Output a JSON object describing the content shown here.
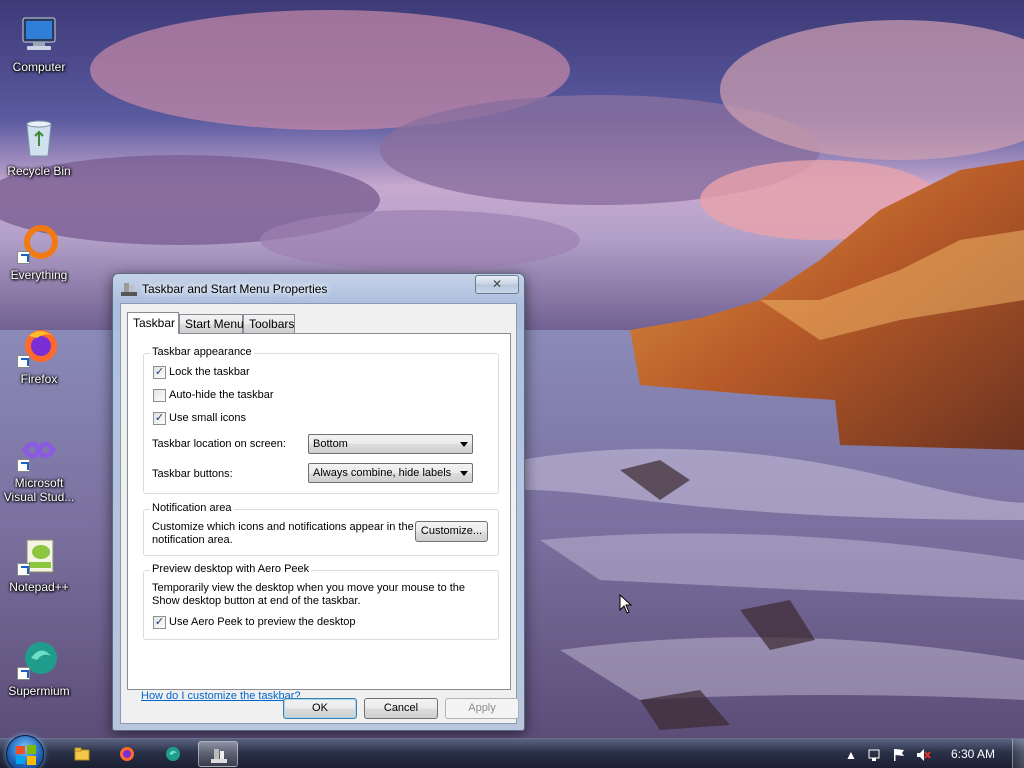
{
  "desktop": {
    "icons": [
      {
        "label": "Computer"
      },
      {
        "label": "Recycle Bin"
      },
      {
        "label": "Everything"
      },
      {
        "label": "Firefox"
      },
      {
        "label": "Microsoft Visual Stud..."
      },
      {
        "label": "Notepad++"
      },
      {
        "label": "Supermium"
      }
    ]
  },
  "dialog": {
    "title": "Taskbar and Start Menu Properties",
    "close_label": "✕",
    "tabs": [
      {
        "label": "Taskbar",
        "active": true
      },
      {
        "label": "Start Menu",
        "active": false
      },
      {
        "label": "Toolbars",
        "active": false
      }
    ],
    "taskbar_appearance": {
      "title": "Taskbar appearance",
      "lock_taskbar": {
        "label": "Lock the taskbar",
        "checked": true
      },
      "auto_hide": {
        "label": "Auto-hide the taskbar",
        "checked": false
      },
      "small_icons": {
        "label": "Use small icons",
        "checked": true
      },
      "location_label": "Taskbar location on screen:",
      "location_value": "Bottom",
      "buttons_label": "Taskbar buttons:",
      "buttons_value": "Always combine, hide labels"
    },
    "notification_area": {
      "title": "Notification area",
      "description_line1": "Customize which icons and notifications appear in the",
      "description_line2": "notification area.",
      "customize_label": "Customize..."
    },
    "aero_peek": {
      "title": "Preview desktop with Aero Peek",
      "description_line1": "Temporarily view the desktop when you move your mouse to the",
      "description_line2": "Show desktop button at end of the taskbar.",
      "use_peek": {
        "label": "Use Aero Peek to preview the desktop",
        "checked": true
      }
    },
    "help_link": "How do I customize the taskbar?",
    "buttons": {
      "ok": "OK",
      "cancel": "Cancel",
      "apply": "Apply"
    }
  },
  "taskbar": {
    "clock": "6:30 AM",
    "pinned": [
      "file-explorer-icon",
      "firefox-icon",
      "supermium-icon",
      "taskbar-properties-icon"
    ]
  },
  "colors": {
    "link": "#0066cc",
    "taskbar": "#283046",
    "dialog_frame": "#afc3e1"
  }
}
